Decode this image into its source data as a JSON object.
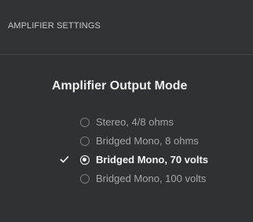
{
  "header": {
    "title": "AMPLIFIER SETTINGS"
  },
  "section": {
    "title": "Amplifier Output Mode"
  },
  "options": [
    {
      "label": "Stereo, 4/8 ohms",
      "selected": false
    },
    {
      "label": "Bridged Mono, 8 ohms",
      "selected": false
    },
    {
      "label": "Bridged Mono, 70 volts",
      "selected": true,
      "check_icon": "checkmark-icon"
    },
    {
      "label": "Bridged Mono, 100 volts",
      "selected": false
    }
  ],
  "colors": {
    "background": "#2f3134",
    "selected_text": "#f4f4f4",
    "unselected_text": "#a4a6a9"
  }
}
